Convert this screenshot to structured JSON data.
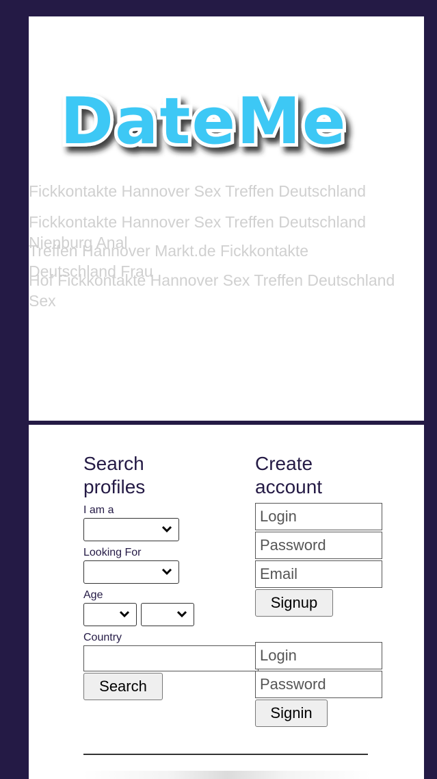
{
  "logo": {
    "text": "DateMe",
    "colors": {
      "fill": "#3cc8f5",
      "outline": "#ffffff",
      "shadow": "#1a1a1a"
    }
  },
  "overlap_text": [
    "Fickkontakte Hannover Sex Treffen Deutschland",
    "Fickkontakte Hannover Sex Treffen Deutschland Nienburg Anal",
    "Treffen Hannover Markt.de Fickkontakte Deutschland Frau",
    "Hof Fickkontakte Hannover Sex Treffen Deutschland Sex"
  ],
  "search": {
    "title": "Search profiles",
    "i_am_label": "I am a",
    "looking_for_label": "Looking For",
    "age_label": "Age",
    "country_label": "Country",
    "country_value": "",
    "button": "Search"
  },
  "create": {
    "title": "Create account",
    "login_placeholder": "Login",
    "password_placeholder": "Password",
    "email_placeholder": "Email",
    "button": "Signup"
  },
  "signin": {
    "login_placeholder": "Login",
    "password_placeholder": "Password",
    "button": "Signin"
  },
  "colors": {
    "background": "#241a45",
    "text": "#241a45",
    "ghost_text": "#d0d0d0"
  }
}
